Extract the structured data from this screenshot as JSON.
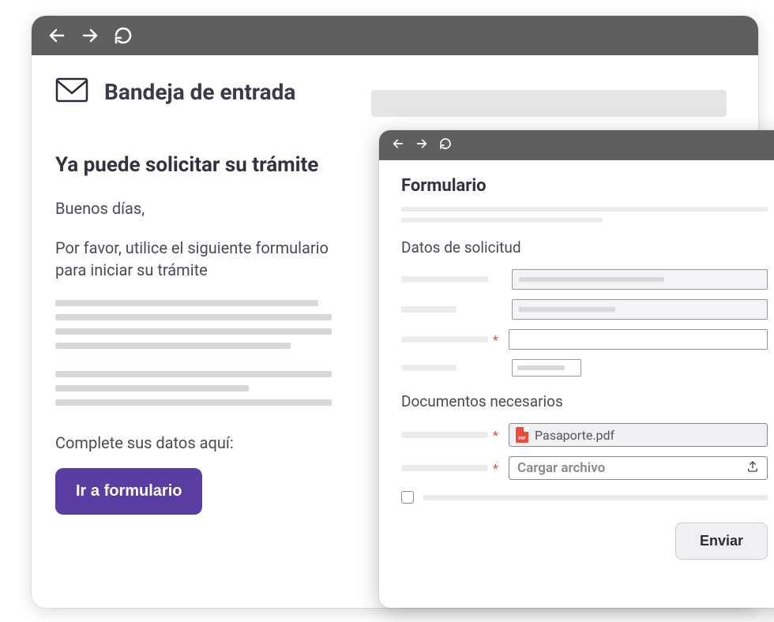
{
  "inbox": {
    "title": "Bandeja de entrada"
  },
  "email": {
    "subject": "Ya puede solicitar su trámite",
    "greeting": "Buenos días,",
    "intro": "Por favor, utilice el siguiente formulario para iniciar su trámite",
    "cta_text": "Complete sus datos aquí:",
    "cta_button": "Ir a formulario"
  },
  "form": {
    "title": "Formulario",
    "section_data": "Datos de solicitud",
    "section_docs": "Documentos necesarios",
    "uploaded_file": "Pasaporte.pdf",
    "upload_label": "Cargar archivo",
    "submit": "Enviar"
  }
}
